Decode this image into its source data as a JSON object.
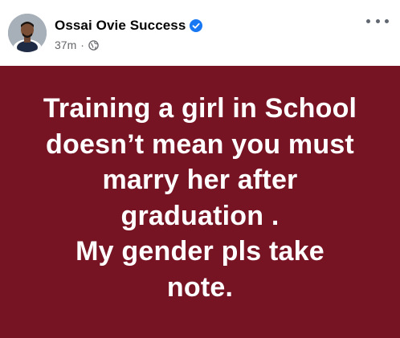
{
  "post": {
    "author": "Ossai Ovie Success",
    "verified_icon": "verified-badge-icon",
    "timestamp": "37m",
    "separator": "·",
    "audience_icon": "globe-icon",
    "more_icon": "more-options-icon",
    "body_text": "Training a girl in School\ndoesn’t mean you must\nmarry her after\ngraduation .\nMy gender pls take\nnote.",
    "colors": {
      "background_panel": "#771424",
      "text_on_panel": "#ffffff",
      "author_name": "#050505",
      "meta": "#65676b",
      "verified": "#1877f2"
    }
  }
}
